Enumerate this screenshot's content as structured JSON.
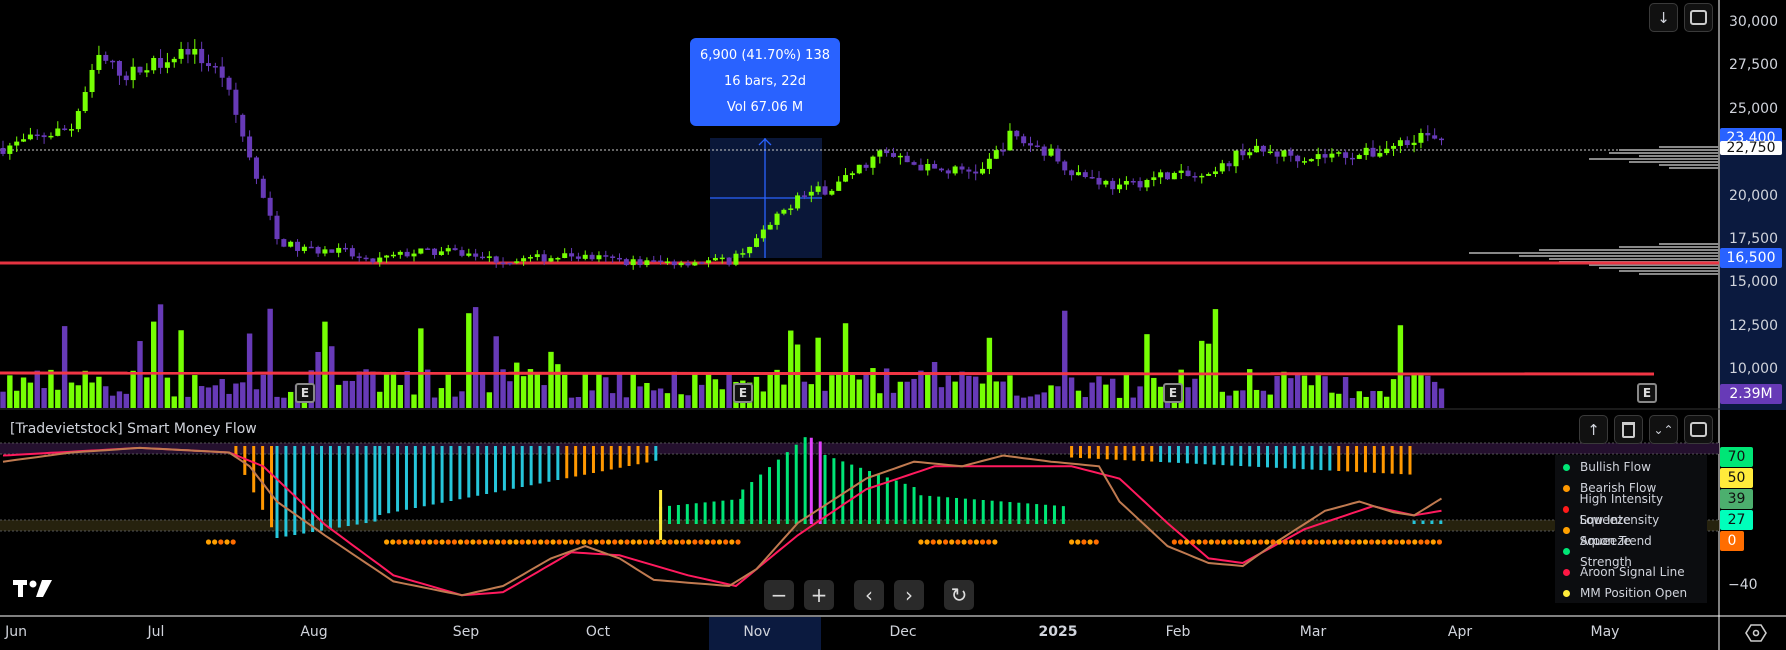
{
  "chart_data": {
    "type": "candlestick",
    "price_axis": {
      "ticks": [
        "30,000",
        "27,500",
        "25,000",
        "20,000",
        "17,500",
        "15,000",
        "12,500",
        "10,000"
      ],
      "tick_values": [
        30000,
        27500,
        25000,
        20000,
        17500,
        15000,
        12500,
        10000
      ]
    },
    "last_price": "23,400",
    "prev_label": "22,750",
    "support_price": "16,500",
    "volume_label": "2.39M",
    "close_keypoints": [
      [
        0,
        22800
      ],
      [
        10,
        24000
      ],
      [
        14,
        28000
      ],
      [
        18,
        27000
      ],
      [
        27,
        28500
      ],
      [
        32,
        27000
      ],
      [
        35,
        23500
      ],
      [
        37,
        21000
      ],
      [
        40,
        17500
      ],
      [
        43,
        17000
      ],
      [
        50,
        16800
      ],
      [
        53,
        16200
      ],
      [
        60,
        16800
      ],
      [
        66,
        16800
      ],
      [
        73,
        16300
      ],
      [
        83,
        16600
      ],
      [
        93,
        16200
      ],
      [
        106,
        16300
      ],
      [
        110,
        17500
      ],
      [
        116,
        20000
      ],
      [
        121,
        20500
      ],
      [
        128,
        22500
      ],
      [
        136,
        21500
      ],
      [
        143,
        21500
      ],
      [
        147,
        23500
      ],
      [
        153,
        22500
      ],
      [
        156,
        21500
      ],
      [
        163,
        20500
      ],
      [
        170,
        21300
      ],
      [
        176,
        21000
      ],
      [
        181,
        22700
      ],
      [
        190,
        22300
      ],
      [
        200,
        22500
      ],
      [
        207,
        23600
      ],
      [
        210,
        23000
      ]
    ],
    "months": [
      "Jun",
      "Jul",
      "Aug",
      "Sep",
      "Oct",
      "Nov",
      "Dec",
      "2025",
      "Feb",
      "Mar",
      "Apr",
      "May"
    ],
    "measure": {
      "line1": "6,900 (41.70%) 138",
      "line2": "16 bars, 22d",
      "line3": "Vol 67.06 M"
    },
    "earnings_marker": "E"
  },
  "indicator": {
    "title": "[Tradevietstock] Smart Money Flow",
    "levels": [
      {
        "v": "70",
        "c": "#00e676"
      },
      {
        "v": "50",
        "c": "#ffeb3b"
      },
      {
        "v": "39",
        "c": "#4caf6e"
      },
      {
        "v": "27",
        "c": "#00ffbb"
      },
      {
        "v": "0",
        "c": "#ff6d00"
      }
    ],
    "axis_min_label": "−40",
    "legend": [
      {
        "label": "Bullish Flow",
        "color": "#00e676"
      },
      {
        "label": "Bearish Flow",
        "color": "#ff9800"
      },
      {
        "label": "High Intensity Squeeze",
        "color": "#ff1a1a"
      },
      {
        "label": "Low Intensity Squeeze",
        "color": "#ffa000"
      },
      {
        "label": "Aroon Trend Strength",
        "color": "#00e676"
      },
      {
        "label": "Aroon Signal Line",
        "color": "#ff1744"
      },
      {
        "label": "MM Position Open",
        "color": "#ffeb3b"
      }
    ],
    "trend_line": [
      [
        0,
        65
      ],
      [
        10,
        71
      ],
      [
        20,
        74
      ],
      [
        33,
        71
      ],
      [
        36,
        62
      ],
      [
        40,
        39
      ],
      [
        47,
        17
      ],
      [
        57,
        -13
      ],
      [
        67,
        -22
      ],
      [
        73,
        -16
      ],
      [
        80,
        2
      ],
      [
        85,
        10
      ],
      [
        90,
        2
      ],
      [
        95,
        -12
      ],
      [
        106,
        -16
      ],
      [
        110,
        -5
      ],
      [
        116,
        25
      ],
      [
        126,
        54
      ],
      [
        133,
        65
      ],
      [
        140,
        62
      ],
      [
        146,
        69
      ],
      [
        153,
        65
      ],
      [
        160,
        62
      ],
      [
        163,
        39
      ],
      [
        170,
        10
      ],
      [
        176,
        -1
      ],
      [
        181,
        -3
      ],
      [
        186,
        13
      ],
      [
        193,
        33
      ],
      [
        198,
        39
      ],
      [
        203,
        32
      ],
      [
        206,
        30
      ],
      [
        210,
        41
      ]
    ],
    "signal_line": [
      [
        0,
        69
      ],
      [
        20,
        74
      ],
      [
        33,
        71
      ],
      [
        38,
        62
      ],
      [
        47,
        24
      ],
      [
        57,
        -9
      ],
      [
        67,
        -22
      ],
      [
        73,
        -20
      ],
      [
        83,
        6
      ],
      [
        90,
        4
      ],
      [
        100,
        -9
      ],
      [
        107,
        -16
      ],
      [
        116,
        17
      ],
      [
        126,
        47
      ],
      [
        136,
        62
      ],
      [
        146,
        62
      ],
      [
        156,
        62
      ],
      [
        163,
        54
      ],
      [
        170,
        25
      ],
      [
        176,
        2
      ],
      [
        181,
        -1
      ],
      [
        190,
        21
      ],
      [
        200,
        36
      ],
      [
        206,
        30
      ],
      [
        210,
        33
      ]
    ],
    "histogram_segments": [
      [
        34,
        40,
        -10,
        -80,
        "#ff9800"
      ],
      [
        40,
        55,
        -80,
        -65,
        "mix"
      ],
      [
        55,
        96,
        -60,
        -12,
        "mix"
      ],
      [
        96,
        108,
        15,
        22,
        "#00e676"
      ],
      [
        108,
        118,
        30,
        80,
        "#00e676"
      ],
      [
        118,
        120,
        75,
        70,
        "#e040fb"
      ],
      [
        120,
        134,
        60,
        30,
        "#00e676"
      ],
      [
        134,
        156,
        25,
        15,
        "#00e676"
      ],
      [
        156,
        206,
        -10,
        -25,
        "mix"
      ],
      [
        206,
        210,
        3,
        3,
        "#26c6da"
      ]
    ],
    "squeeze_dot_ranges": [
      [
        30,
        34
      ],
      [
        56,
        108
      ],
      [
        134,
        145
      ],
      [
        156,
        160
      ],
      [
        171,
        210
      ]
    ]
  },
  "toolbar": {
    "scroll_icon": "↓",
    "fullscreen_icon": "⛶",
    "up_icon": "↑",
    "delete_icon": "🗑",
    "collapse_icon": "✕"
  },
  "controls": {
    "zoom_out": "−",
    "zoom_in": "+",
    "left": "‹",
    "right": "›",
    "reset": "↻"
  },
  "colors": {
    "up": "#76ff03",
    "down": "#673ab7",
    "support": "#f23645",
    "accent": "#2962ff"
  }
}
